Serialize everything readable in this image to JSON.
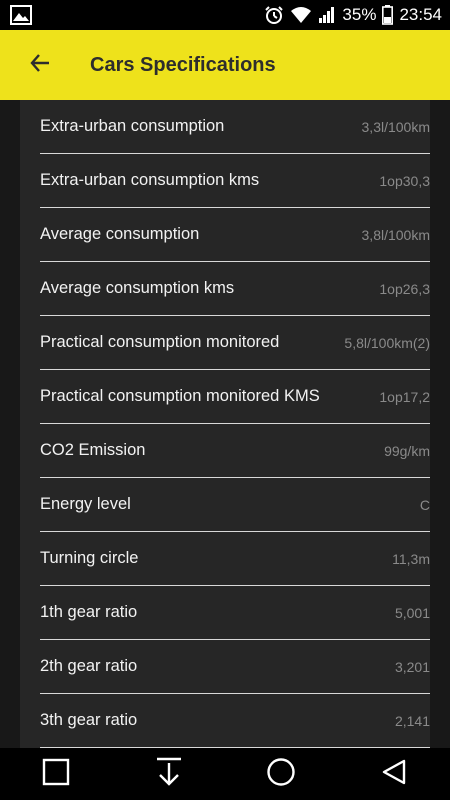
{
  "status_bar": {
    "battery_percent": "35%",
    "time": "23:54",
    "icons": [
      "image-icon",
      "alarm-icon",
      "wifi-icon",
      "signal-icon",
      "battery-icon"
    ]
  },
  "app_bar": {
    "title": "Cars Specifications",
    "back_icon": "arrow-left-icon",
    "background_color": "#EEE21B"
  },
  "specs": [
    {
      "label": "Extra-urban consumption",
      "value": "3,3l/100km"
    },
    {
      "label": "Extra-urban consumption kms",
      "value": "1op30,3"
    },
    {
      "label": "Average consumption",
      "value": "3,8l/100km"
    },
    {
      "label": "Average consumption kms",
      "value": "1op26,3"
    },
    {
      "label": "Practical consumption monitored",
      "value": "5,8l/100km(2)"
    },
    {
      "label": "Practical consumption monitored KMS",
      "value": "1op17,2"
    },
    {
      "label": "CO2 Emission",
      "value": "99g/km"
    },
    {
      "label": "Energy level",
      "value": "C"
    },
    {
      "label": "Turning circle",
      "value": "11,3m"
    },
    {
      "label": "1th gear ratio",
      "value": "5,001"
    },
    {
      "label": "2th gear ratio",
      "value": "3,201"
    },
    {
      "label": "3th gear ratio",
      "value": "2,141"
    }
  ],
  "nav_bar": {
    "icons": [
      "recents-square-icon",
      "download-arrow-icon",
      "home-circle-icon",
      "back-triangle-icon"
    ]
  }
}
